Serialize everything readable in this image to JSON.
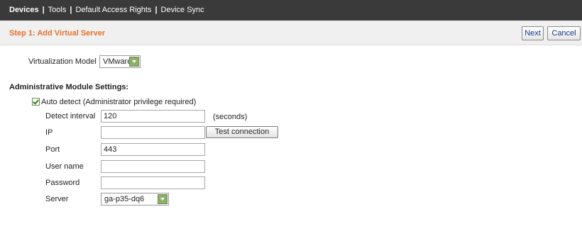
{
  "nav": {
    "items": [
      "Devices",
      "Tools",
      "Default Access Rights",
      "Device Sync"
    ],
    "separator": "|"
  },
  "step": {
    "title": "Step 1: Add Virtual Server",
    "next_label": "Next",
    "cancel_label": "Cancel"
  },
  "virtualization": {
    "label": "Virtualization Model",
    "value": "VMware"
  },
  "admin": {
    "section_title": "Administrative Module Settings:",
    "auto_detect_label": "Auto detect (Administrator privilege required)",
    "auto_detect_checked": true,
    "detect_interval_label": "Detect interval",
    "detect_interval_value": "120",
    "detect_interval_unit": "(seconds)",
    "ip_label": "IP",
    "ip_value": "",
    "test_connection_label": "Test connection",
    "port_label": "Port",
    "port_value": "443",
    "username_label": "User name",
    "username_value": "",
    "password_label": "Password",
    "password_value": "",
    "server_label": "Server",
    "server_value": "ga-p35-dq6"
  },
  "colors": {
    "topbar": "#3a3a3a",
    "step_title": "#e8702a",
    "select_arrow": "#8bb06a"
  }
}
